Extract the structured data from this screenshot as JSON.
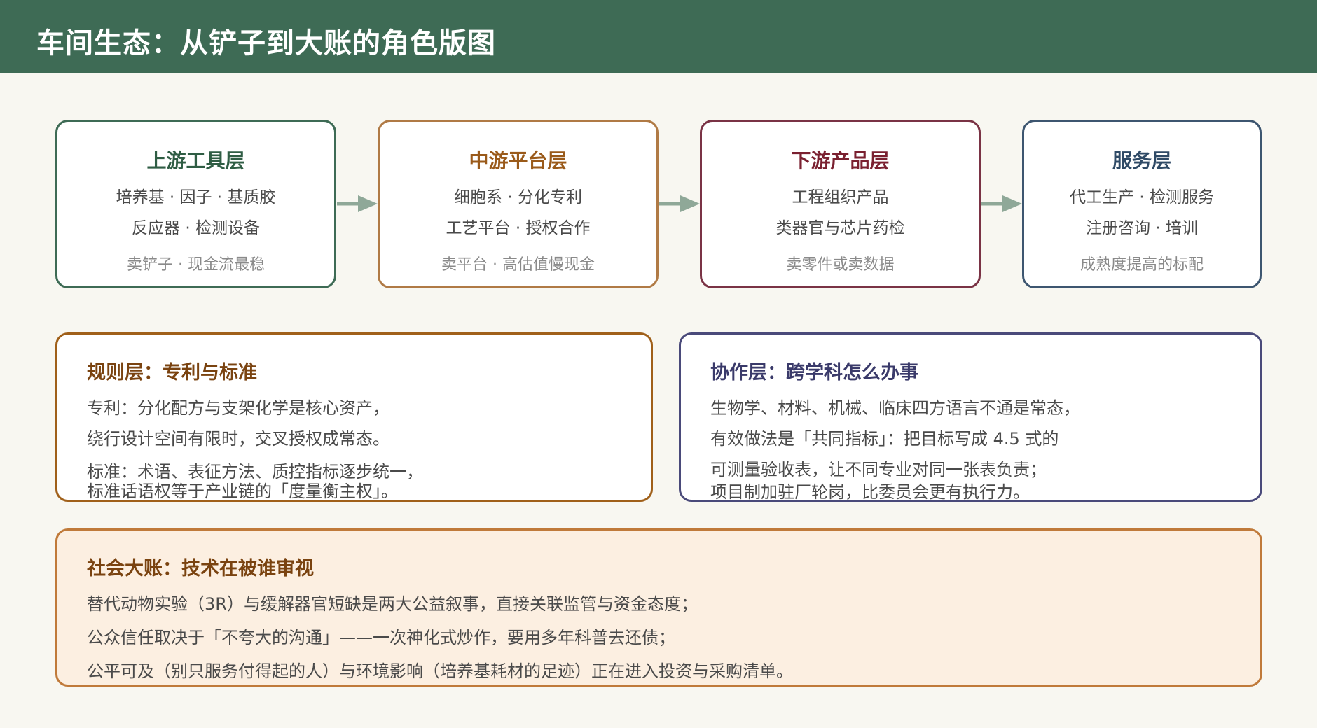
{
  "header": {
    "title": "车间生态：从铲子到大账的角色版图"
  },
  "layers": [
    {
      "title": "上游工具层",
      "line1": "培养基 · 因子 · 基质胶",
      "line2": "反应器 · 检测设备",
      "note": "卖铲子 · 现金流最稳",
      "color": "#3e6b55",
      "title_color": "#2f5d44"
    },
    {
      "title": "中游平台层",
      "line1": "细胞系 · 分化专利",
      "line2": "工艺平台 · 授权合作",
      "note": "卖平台 · 高估值慢现金",
      "color": "#b07a45",
      "title_color": "#9a5a1a"
    },
    {
      "title": "下游产品层",
      "line1": "工程组织产品",
      "line2": "类器官与芯片药检",
      "note": "卖零件或卖数据",
      "color": "#7a3345",
      "title_color": "#7a2030"
    },
    {
      "title": "服务层",
      "line1": "代工生产 · 检测服务",
      "line2": "注册咨询 · 培训",
      "note": "成熟度提高的标配",
      "color": "#3d5670",
      "title_color": "#2f4a66"
    }
  ],
  "rules": {
    "title": "规则层：专利与标准",
    "lines": [
      "专利：分化配方与支架化学是核心资产，",
      "绕行设计空间有限时，交叉授权成常态。",
      "标准：术语、表征方法、质控指标逐步统一，",
      "标准话语权等于产业链的「度量衡主权」。"
    ],
    "color": "#a0601a",
    "title_color": "#7a4310"
  },
  "collab": {
    "title": "协作层：跨学科怎么办事",
    "lines": [
      "生物学、材料、机械、临床四方语言不通是常态，",
      "有效做法是「共同指标」：把目标写成 4.5 式的",
      "可测量验收表，让不同专业对同一张表负责；",
      "项目制加驻厂轮岗，比委员会更有执行力。"
    ],
    "color": "#4a4a7a",
    "title_color": "#3a3a6a"
  },
  "social": {
    "title": "社会大账：技术在被谁审视",
    "lines": [
      "替代动物实验（3R）与缓解器官短缺是两大公益叙事，直接关联监管与资金态度；",
      "公众信任取决于「不夸大的沟通」——一次神化式炒作，要用多年科普去还债；",
      "公平可及（别只服务付得起的人）与环境影响（培养基耗材的足迹）正在进入投资与采购清单。"
    ],
    "color": "#c07a3a",
    "background": "#fcefe1",
    "title_color": "#7a4310"
  },
  "arrow_color": "#8fa898",
  "header_color": "#3e6b55"
}
